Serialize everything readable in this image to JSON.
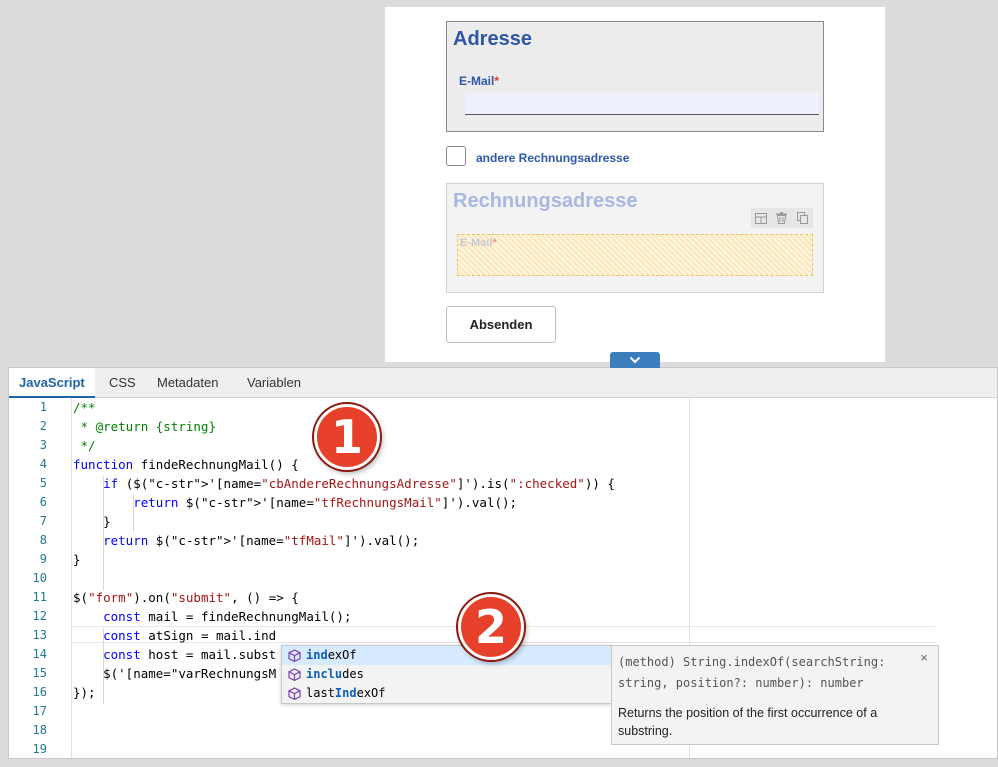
{
  "preview": {
    "address_title": "Adresse",
    "email_label": "E-Mail",
    "required_mark": "*",
    "billing_checkbox_label": "andere Rechnungsadresse",
    "billing_title": "Rechnungsadresse",
    "billing_email_label": "E-Mail",
    "submit_label": "Absenden"
  },
  "editor": {
    "tabs": [
      {
        "label": "JavaScript",
        "active": true
      },
      {
        "label": "CSS"
      },
      {
        "label": "Metadaten"
      },
      {
        "label": "Variablen"
      }
    ],
    "line_numbers": [
      "1",
      "2",
      "3",
      "4",
      "5",
      "6",
      "7",
      "8",
      "9",
      "10",
      "11",
      "12",
      "13",
      "14",
      "15",
      "16",
      "17",
      "18",
      "19"
    ],
    "code_lines": [
      "/**",
      " * @return {string}",
      " */",
      "function findeRechnungMail() {",
      "    if ($('[name=\"cbAndereRechnungsAdresse\"]').is(\":checked\")) {",
      "        return $('[name=\"tfRechnungsMail\"]').val();",
      "    }",
      "    return $('[name=\"tfMail\"]').val();",
      "}",
      "",
      "$(\"form\").on(\"submit\", () => {",
      "    const mail = findeRechnungMail();",
      "    const atSign = mail.ind",
      "    const host = mail.subst",
      "    $('[name=\"varRechnungsM",
      "});",
      "",
      "",
      ""
    ],
    "suggestions": [
      {
        "match": "ind",
        "rest": "exOf",
        "selected": true
      },
      {
        "match": "inclu",
        "rest": "des",
        "selected": false
      },
      {
        "pre": "last",
        "match": "Ind",
        "rest": "exOf",
        "selected": false
      }
    ],
    "tooltip": {
      "signature": "(method) String.indexOf(searchString: string, position?: number): number",
      "description": "Returns the position of the first occurrence of a substring.",
      "close": "×"
    }
  },
  "callouts": [
    "1",
    "2"
  ],
  "colors": {
    "accent": "#1f63a8",
    "callout": "#e8412b",
    "form_title": "#2e57a8"
  }
}
